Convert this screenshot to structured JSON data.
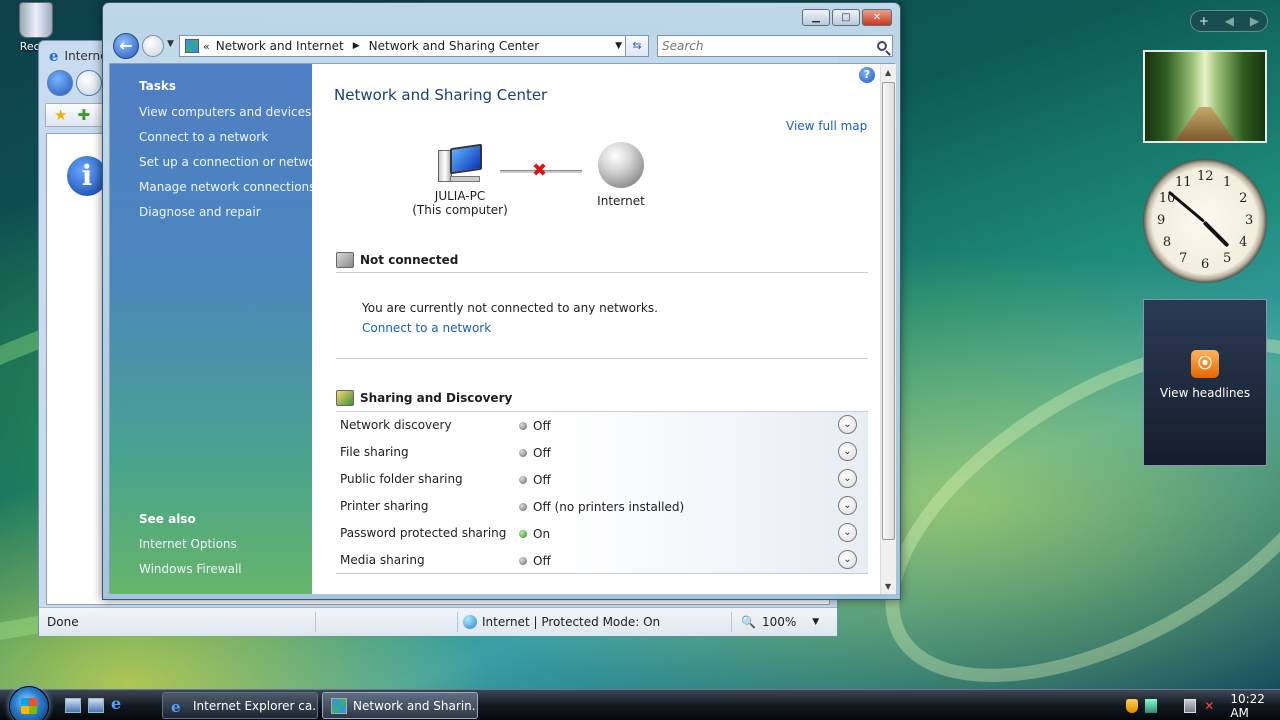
{
  "desktop": {
    "recycle_label": "Recyc"
  },
  "ie_window": {
    "title": "Interne",
    "status_text": "Done",
    "zone_text": "Internet | Protected Mode: On",
    "zoom_text": "100%"
  },
  "main_window": {
    "breadcrumb": [
      "Network and Internet",
      "Network and Sharing Center"
    ],
    "search_placeholder": "Search",
    "page_title": "Network and Sharing Center",
    "view_full_map": "View full map",
    "help_glyph": "?",
    "sidebar": {
      "tasks_heading": "Tasks",
      "tasks": [
        "View computers and devices",
        "Connect to a network",
        "Set up a connection or network",
        "Manage network connections",
        "Diagnose and repair"
      ],
      "see_also_heading": "See also",
      "see_also": [
        "Internet Options",
        "Windows Firewall"
      ]
    },
    "map": {
      "computer_name": "JULIA-PC",
      "computer_sub": "(This computer)",
      "internet_label": "Internet"
    },
    "network_section": {
      "heading": "Not connected",
      "message": "You are currently not connected to any networks.",
      "connect_link": "Connect to a network"
    },
    "sharing": {
      "heading": "Sharing and Discovery",
      "rows": [
        {
          "label": "Network discovery",
          "status": "Off",
          "on": false
        },
        {
          "label": "File sharing",
          "status": "Off",
          "on": false
        },
        {
          "label": "Public folder sharing",
          "status": "Off",
          "on": false
        },
        {
          "label": "Printer sharing",
          "status": "Off (no printers installed)",
          "on": false
        },
        {
          "label": "Password protected sharing",
          "status": "On",
          "on": true
        },
        {
          "label": "Media sharing",
          "status": "Off",
          "on": false
        }
      ]
    }
  },
  "gadgets": {
    "feed_label": "View headlines",
    "rss_glyph": "⦿",
    "clock_numbers": [
      "12",
      "1",
      "2",
      "3",
      "4",
      "5",
      "6",
      "7",
      "8",
      "9",
      "10",
      "11"
    ]
  },
  "taskbar": {
    "buttons": [
      "Internet Explorer ca...",
      "Network and Sharin..."
    ],
    "time": "10:22 AM"
  },
  "colors": {
    "link": "#1a5ec0",
    "title": "#1a3f7a",
    "on_dot": "#1f8a12"
  }
}
